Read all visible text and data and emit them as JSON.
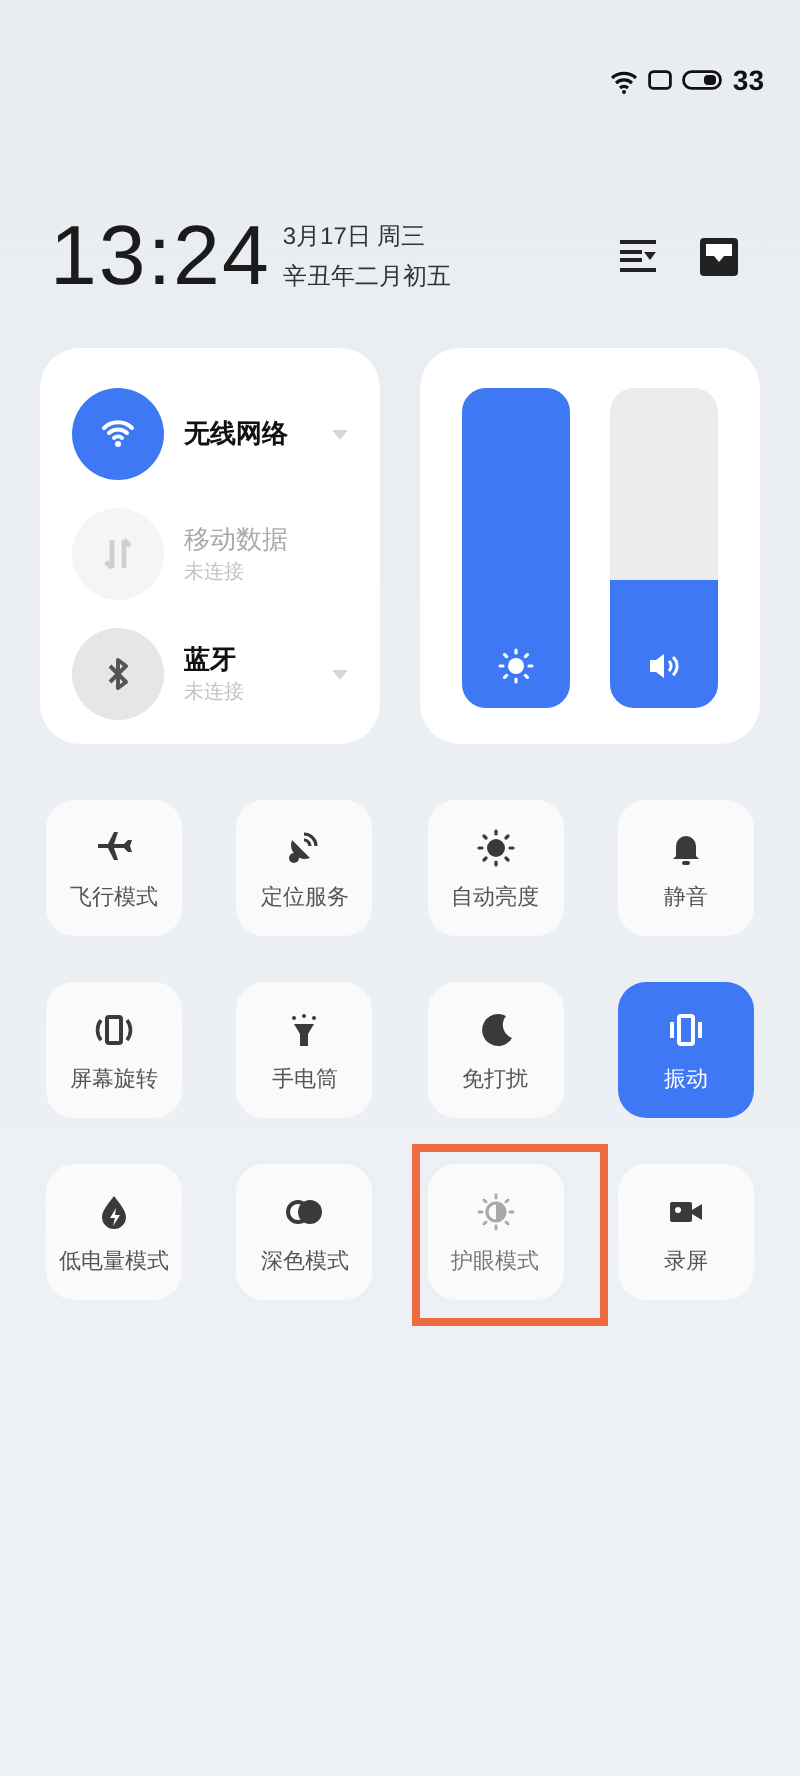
{
  "status_bar": {
    "battery_text": "33"
  },
  "header": {
    "time": "13:24",
    "date": "3月17日 周三",
    "lunar_date": "辛丑年二月初五"
  },
  "connections": [
    {
      "title": "无线网络",
      "on": true,
      "disabled": false,
      "menu": true
    },
    {
      "title": "移动数据",
      "subtitle": "未连接",
      "on": false,
      "disabled": true,
      "menu": false
    },
    {
      "title": "蓝牙",
      "subtitle": "未连接",
      "on": false,
      "disabled": false,
      "menu": true
    }
  ],
  "sliders": [
    {
      "level": 1.0
    },
    {
      "level": 0.4
    }
  ],
  "tiles": [
    {
      "label": "飞行模式",
      "on": false,
      "disabled": false,
      "highlighted": false
    },
    {
      "label": "定位服务",
      "on": false,
      "disabled": false,
      "highlighted": false
    },
    {
      "label": "自动亮度",
      "on": false,
      "disabled": false,
      "highlighted": false
    },
    {
      "label": "静音",
      "on": false,
      "disabled": false,
      "highlighted": false
    },
    {
      "label": "屏幕旋转",
      "on": false,
      "disabled": false,
      "highlighted": false
    },
    {
      "label": "手电筒",
      "on": false,
      "disabled": false,
      "highlighted": false
    },
    {
      "label": "免打扰",
      "on": false,
      "disabled": false,
      "highlighted": false
    },
    {
      "label": "振动",
      "on": true,
      "disabled": false,
      "highlighted": false
    },
    {
      "label": "低电量模式",
      "on": false,
      "disabled": false,
      "highlighted": false
    },
    {
      "label": "深色模式",
      "on": false,
      "disabled": false,
      "highlighted": false
    },
    {
      "label": "护眼模式",
      "on": false,
      "disabled": true,
      "highlighted": true
    },
    {
      "label": "录屏",
      "on": false,
      "disabled": false,
      "highlighted": false
    }
  ]
}
